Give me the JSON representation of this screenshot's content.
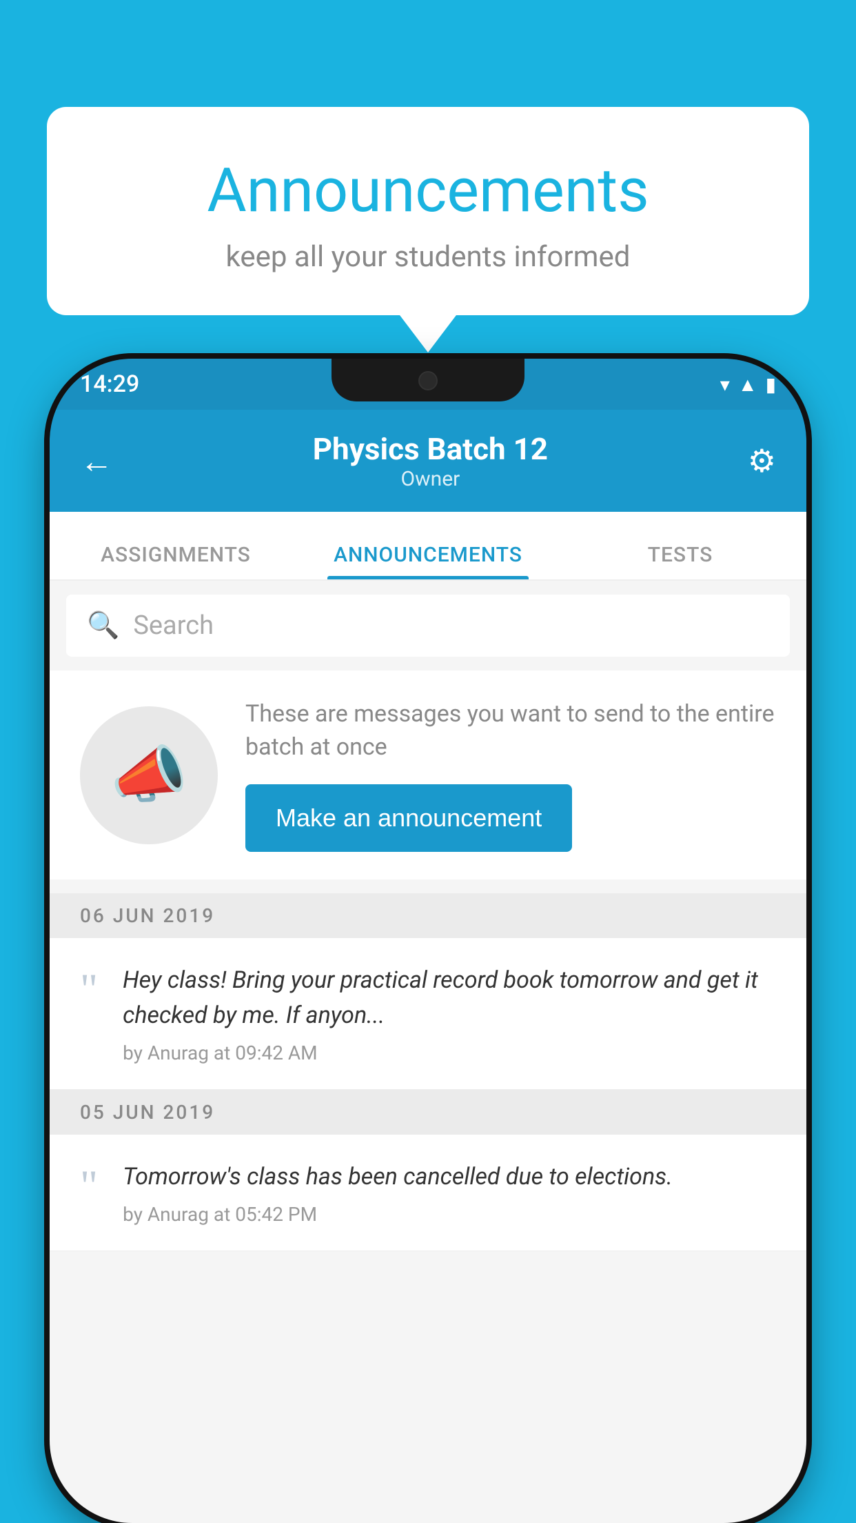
{
  "background_color": "#1ab3e0",
  "speech_bubble": {
    "title": "Announcements",
    "subtitle": "keep all your students informed"
  },
  "phone": {
    "status_bar": {
      "time": "14:29"
    },
    "header": {
      "title": "Physics Batch 12",
      "subtitle": "Owner",
      "back_label": "←",
      "gear_label": "⚙"
    },
    "tabs": [
      {
        "label": "ASSIGNMENTS",
        "active": false
      },
      {
        "label": "ANNOUNCEMENTS",
        "active": true
      },
      {
        "label": "TESTS",
        "active": false
      }
    ],
    "search": {
      "placeholder": "Search"
    },
    "announcement_prompt": {
      "description": "These are messages you want to send to the entire batch at once",
      "button_label": "Make an announcement"
    },
    "announcement_groups": [
      {
        "date": "06  JUN  2019",
        "items": [
          {
            "text": "Hey class! Bring your practical record book tomorrow and get it checked by me. If anyon...",
            "meta": "by Anurag at 09:42 AM"
          }
        ]
      },
      {
        "date": "05  JUN  2019",
        "items": [
          {
            "text": "Tomorrow's class has been cancelled due to elections.",
            "meta": "by Anurag at 05:42 PM"
          }
        ]
      }
    ]
  }
}
